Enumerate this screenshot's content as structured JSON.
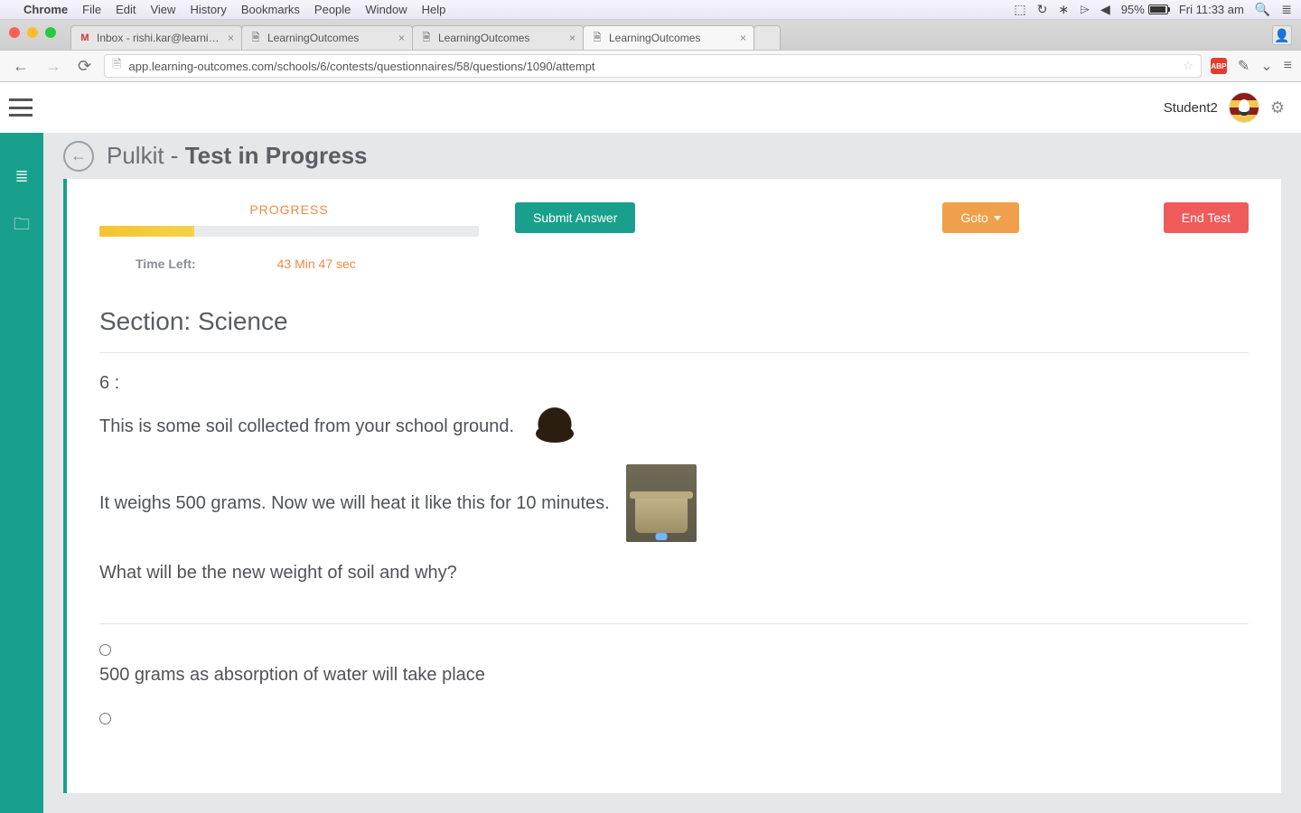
{
  "mac": {
    "app": "Chrome",
    "menus": [
      "File",
      "Edit",
      "View",
      "History",
      "Bookmarks",
      "People",
      "Window",
      "Help"
    ],
    "battery_pct": "95%",
    "clock": "Fri 11:33 am"
  },
  "browser": {
    "tabs": [
      {
        "title": "Inbox - rishi.kar@learning-",
        "favicon": "M"
      },
      {
        "title": "LearningOutcomes",
        "favicon": "▫"
      },
      {
        "title": "LearningOutcomes",
        "favicon": "▫"
      },
      {
        "title": "LearningOutcomes",
        "favicon": "▫",
        "active": true
      }
    ],
    "url": "app.learning-outcomes.com/schools/6/contests/questionnaires/58/questions/1090/attempt",
    "abp": "ABP"
  },
  "app": {
    "username": "Student2",
    "header_prefix": "Pulkit - ",
    "header_bold": "Test in Progress",
    "progress_label": "PROGRESS",
    "progress_pct": 25,
    "submit_btn": "Submit Answer",
    "goto_btn": "Goto",
    "end_btn": "End Test",
    "time_label": "Time Left:",
    "time_value": "43 Min 47 sec",
    "section_title": "Section: Science",
    "question_number": "6 :",
    "q_line1": "This is some soil collected from your school ground.",
    "q_line2": "It weighs 500 grams.  Now we will heat it like this for 10 minutes.",
    "q_line3": "What will be the  new weight of soil and why?",
    "options": [
      "500 grams as absorption of water will take place"
    ]
  }
}
